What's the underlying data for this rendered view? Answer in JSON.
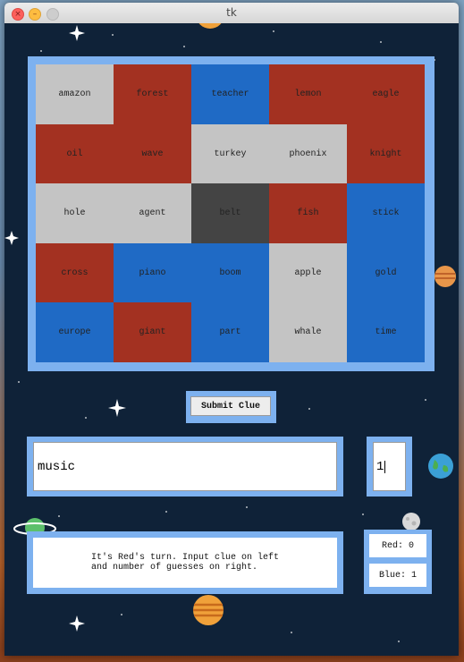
{
  "window": {
    "title": "tk"
  },
  "board": {
    "cards": [
      {
        "word": "amazon",
        "team": "neutral"
      },
      {
        "word": "forest",
        "team": "red"
      },
      {
        "word": "teacher",
        "team": "blue"
      },
      {
        "word": "lemon",
        "team": "red"
      },
      {
        "word": "eagle",
        "team": "red"
      },
      {
        "word": "oil",
        "team": "red"
      },
      {
        "word": "wave",
        "team": "red"
      },
      {
        "word": "turkey",
        "team": "neutral"
      },
      {
        "word": "phoenix",
        "team": "neutral"
      },
      {
        "word": "knight",
        "team": "red"
      },
      {
        "word": "hole",
        "team": "neutral"
      },
      {
        "word": "agent",
        "team": "neutral"
      },
      {
        "word": "belt",
        "team": "assassin"
      },
      {
        "word": "fish",
        "team": "red"
      },
      {
        "word": "stick",
        "team": "blue"
      },
      {
        "word": "cross",
        "team": "red"
      },
      {
        "word": "piano",
        "team": "blue"
      },
      {
        "word": "boom",
        "team": "blue"
      },
      {
        "word": "apple",
        "team": "neutral"
      },
      {
        "word": "gold",
        "team": "blue"
      },
      {
        "word": "europe",
        "team": "blue"
      },
      {
        "word": "giant",
        "team": "red"
      },
      {
        "word": "part",
        "team": "blue"
      },
      {
        "word": "whale",
        "team": "neutral"
      },
      {
        "word": "time",
        "team": "blue"
      }
    ]
  },
  "controls": {
    "submit_label": "Submit Clue",
    "clue_value": "music",
    "number_value": "1"
  },
  "status": {
    "message": "It's Red's turn. Input clue on left\nand number of guesses on right.",
    "red_score": "Red: 0",
    "blue_score": "Blue: 1"
  },
  "colors": {
    "red": "#a33121",
    "blue": "#1f6ac5",
    "neutral": "#c4c4c4",
    "assassin": "#444444",
    "frame": "#7db1ef",
    "background": "#0f2238"
  }
}
